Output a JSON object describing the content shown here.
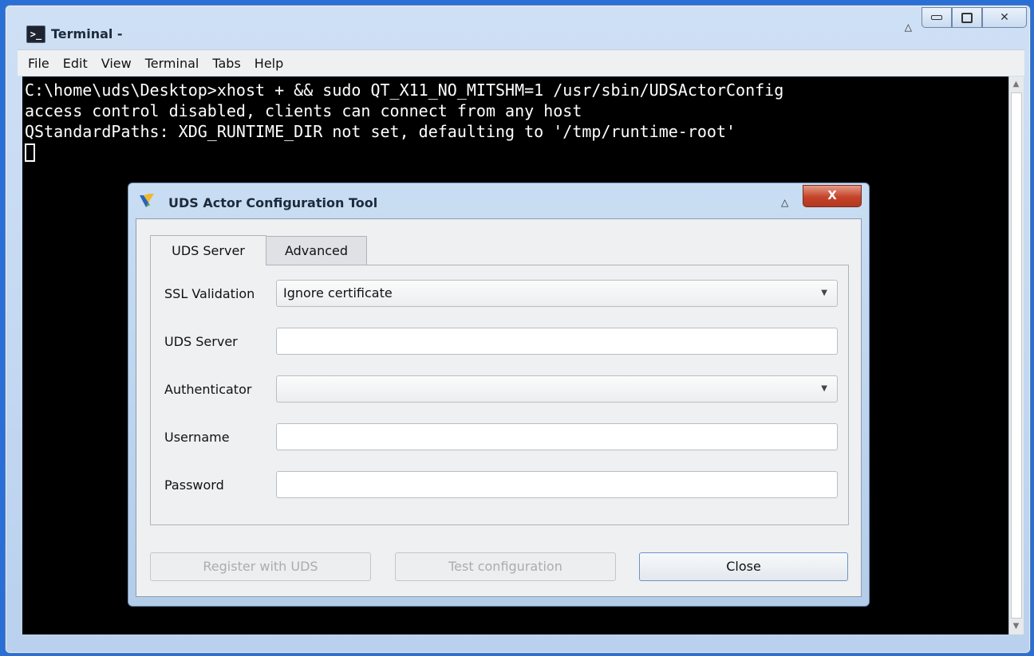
{
  "terminal": {
    "title": "Terminal -",
    "icon_glyph": ">_",
    "menu": [
      "File",
      "Edit",
      "View",
      "Terminal",
      "Tabs",
      "Help"
    ],
    "lines": [
      "C:\\home\\uds\\Desktop>xhost + && sudo QT_X11_NO_MITSHM=1 /usr/sbin/UDSActorConfig",
      "access control disabled, clients can connect from any host",
      "QStandardPaths: XDG_RUNTIME_DIR not set, defaulting to '/tmp/runtime-root'"
    ]
  },
  "dialog": {
    "title": "UDS Actor Configuration Tool",
    "close_glyph": "X",
    "tabs": [
      {
        "label": "UDS Server",
        "active": true
      },
      {
        "label": "Advanced",
        "active": false
      }
    ],
    "fields": {
      "ssl_validation": {
        "label": "SSL Validation",
        "value": "Ignore certificate"
      },
      "uds_server": {
        "label": "UDS Server",
        "value": ""
      },
      "authenticator": {
        "label": "Authenticator",
        "value": ""
      },
      "username": {
        "label": "Username",
        "value": ""
      },
      "password": {
        "label": "Password",
        "value": ""
      }
    },
    "buttons": {
      "register": "Register with UDS",
      "test": "Test configuration",
      "close": "Close"
    }
  },
  "colors": {
    "desktop": "#2a6fd6",
    "terminal_bg": "#000000",
    "terminal_fg": "#ffffff",
    "close_button": "#c4442a"
  }
}
